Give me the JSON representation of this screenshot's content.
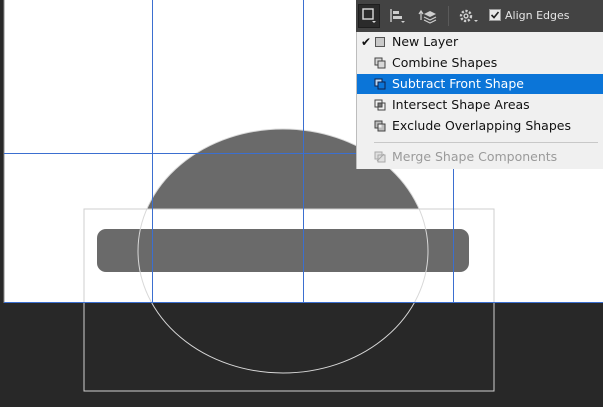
{
  "toolbar": {
    "align_edges_label": "Align Edges",
    "align_edges_checked": true,
    "buttons": [
      {
        "name": "path-operations-icon",
        "pressed": true
      },
      {
        "name": "path-alignment-icon",
        "pressed": false
      },
      {
        "name": "path-arrangement-icon",
        "pressed": false
      },
      {
        "name": "settings-gear-icon",
        "pressed": false
      }
    ]
  },
  "menu": {
    "items": [
      {
        "label": "New Layer",
        "checked": true,
        "highlighted": false,
        "disabled": false,
        "icon": "new-layer-icon"
      },
      {
        "label": "Combine Shapes",
        "checked": false,
        "highlighted": false,
        "disabled": false,
        "icon": "combine-shapes-icon"
      },
      {
        "label": "Subtract Front Shape",
        "checked": false,
        "highlighted": true,
        "disabled": false,
        "icon": "subtract-front-shape-icon"
      },
      {
        "label": "Intersect Shape Areas",
        "checked": false,
        "highlighted": false,
        "disabled": false,
        "icon": "intersect-shape-areas-icon"
      },
      {
        "label": "Exclude Overlapping Shapes",
        "checked": false,
        "highlighted": false,
        "disabled": false,
        "icon": "exclude-overlapping-shapes-icon"
      },
      {
        "label": "Merge Shape Components",
        "checked": false,
        "highlighted": false,
        "disabled": true,
        "icon": "merge-shape-components-icon"
      }
    ]
  },
  "colors": {
    "canvas": "#ffffff",
    "pasteboard": "#282828",
    "shape_fill": "#6a6a6a",
    "guide": "#3b6fd0",
    "highlight": "#0b75d8",
    "menu_bg": "#f0f0f0",
    "toolbar_bg": "#434343"
  }
}
